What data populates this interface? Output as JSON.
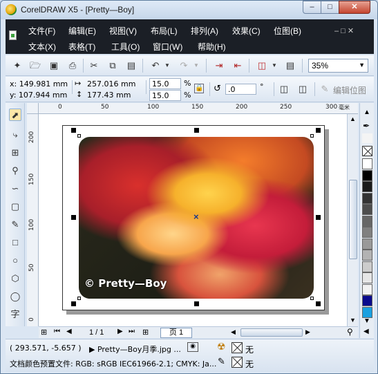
{
  "window": {
    "title": "CorelDRAW X5 - [Pretty—Boy]",
    "min_label": "–",
    "max_label": "□",
    "close_label": "✕"
  },
  "menu": {
    "row1": [
      "文件(F)",
      "编辑(E)",
      "视图(V)",
      "布局(L)",
      "排列(A)",
      "效果(C)",
      "位图(B)"
    ],
    "row2": [
      "文本(X)",
      "表格(T)",
      "工具(O)",
      "窗口(W)",
      "帮助(H)"
    ],
    "mdi_controls": "– □ ✕"
  },
  "toolbar": {
    "icons": [
      "new-icon",
      "open-icon",
      "save-icon",
      "print-icon",
      "cut-icon",
      "copy-icon",
      "paste-icon",
      "undo-icon",
      "redo-icon",
      "import-icon",
      "export-icon",
      "publish-icon",
      "app-launcher-icon"
    ],
    "zoom": "35%"
  },
  "properties": {
    "x": "x:  149.981 mm",
    "y": "y:  107.944 mm",
    "width": "257.016 mm",
    "height": "177.43 mm",
    "scale_w": "15.0",
    "scale_h": "15.0",
    "percent": "%",
    "rotation": ".0",
    "degree": "°",
    "edit_bitmap": "编辑位图"
  },
  "ruler": {
    "top_ticks": [
      "0",
      "50",
      "100",
      "150",
      "200",
      "250",
      "300"
    ],
    "unit": "毫米",
    "left_ticks": [
      "200",
      "150",
      "100",
      "50",
      "0"
    ]
  },
  "canvas": {
    "watermark": "© Pretty—Boy"
  },
  "pages": {
    "counter": "1 / 1",
    "tab": "页 1"
  },
  "palette": [
    "#ffffff",
    "#000000",
    "#1a1a1a",
    "#333333",
    "#4d4d4d",
    "#666666",
    "#808080",
    "#999999",
    "#b3b3b3",
    "#cccccc",
    "#e6e6e6",
    "#f2f2f2",
    "#0a0a8c",
    "#1aa0e0"
  ],
  "status": {
    "coords": "( 293.571, -5.657 )",
    "object": "▶ Pretty—Boy月季.jpg ...",
    "fill_none": "无",
    "outline_none": "无",
    "color_profile": "文档颜色预置文件: RGB: sRGB IEC61966-2.1; CMYK: Ja..."
  }
}
